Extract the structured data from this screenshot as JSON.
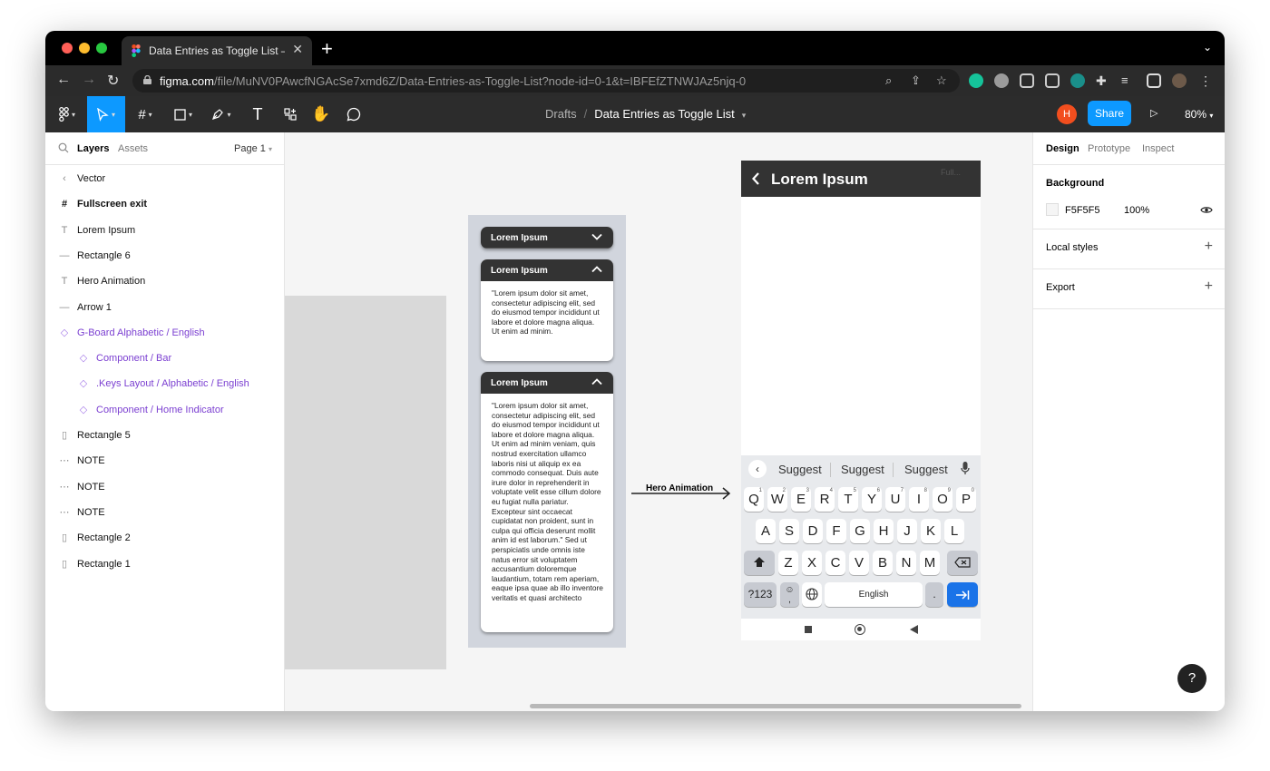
{
  "browser": {
    "tab_title": "Data Entries as Toggle List – Fi",
    "tab_close": "✕",
    "new_tab": "+",
    "url_host": "figma.com",
    "url_path": "/file/MuNV0PAwcfNGAcSe7xmd6Z/Data-Entries-as-Toggle-List?node-id=0-1&t=IBFEfZTNWJAz5njq-0"
  },
  "toolbar": {
    "breadcrumb_parent": "Drafts",
    "breadcrumb_sep": "/",
    "file_name": "Data Entries as Toggle List",
    "user_initial": "H",
    "share_label": "Share",
    "zoom_level": "80%"
  },
  "left_panel": {
    "tab_layers": "Layers",
    "tab_assets": "Assets",
    "page_label": "Page 1",
    "layers": [
      {
        "label": "Vector",
        "icon": "vector-icon"
      },
      {
        "label": "Fullscreen exit",
        "icon": "frame-icon"
      },
      {
        "label": "Lorem Ipsum",
        "icon": "text-icon"
      },
      {
        "label": "Rectangle 6",
        "icon": "line-icon"
      },
      {
        "label": "Hero Animation",
        "icon": "text-icon"
      },
      {
        "label": "Arrow 1",
        "icon": "line-icon"
      },
      {
        "label": "G-Board Alphabetic / English",
        "icon": "component-icon"
      },
      {
        "label": "Component / Bar",
        "icon": "component-icon"
      },
      {
        "label": ".Keys Layout / Alphabetic / English",
        "icon": "component-icon"
      },
      {
        "label": "Component / Home Indicator",
        "icon": "component-icon"
      },
      {
        "label": "Rectangle 5",
        "icon": "rectangle-icon"
      },
      {
        "label": "NOTE",
        "icon": "dashed-frame-icon"
      },
      {
        "label": "NOTE",
        "icon": "dashed-frame-icon"
      },
      {
        "label": "NOTE",
        "icon": "dashed-frame-icon"
      },
      {
        "label": "Rectangle 2",
        "icon": "rectangle-icon"
      },
      {
        "label": "Rectangle 1",
        "icon": "rectangle-icon"
      }
    ]
  },
  "canvas": {
    "cards": [
      {
        "title": "Lorem Ipsum",
        "expanded": false,
        "body": ""
      },
      {
        "title": "Lorem Ipsum",
        "expanded": true,
        "body": "\"Lorem ipsum dolor sit amet, consectetur adipiscing elit, sed do eiusmod tempor incididunt ut labore et dolore magna aliqua. Ut enim ad minim."
      },
      {
        "title": "Lorem Ipsum",
        "expanded": true,
        "body": "\"Lorem ipsum dolor sit amet, consectetur adipiscing elit, sed do eiusmod tempor incididunt ut labore et dolore magna aliqua. Ut enim ad minim veniam, quis nostrud exercitation ullamco laboris nisi ut aliquip ex ea commodo consequat. Duis aute irure dolor in reprehenderit in voluptate velit esse cillum dolore eu fugiat nulla pariatur. Excepteur sint occaecat cupidatat non proident, sunt in culpa qui officia deserunt mollit anim id est laborum.\" Sed ut perspiciatis unde omnis iste natus error sit voluptatem accusantium doloremque laudantium, totam rem aperiam, eaque ipsa quae ab illo inventore veritatis et quasi architecto"
      }
    ],
    "arrow_label": "Hero Animation",
    "phone": {
      "title": "Lorem Ipsum",
      "ghost_text": "Full...",
      "suggestions": [
        "Suggest",
        "Suggest",
        "Suggest"
      ],
      "row1": [
        {
          "k": "Q",
          "n": "1"
        },
        {
          "k": "W",
          "n": "2"
        },
        {
          "k": "E",
          "n": "3"
        },
        {
          "k": "R",
          "n": "4"
        },
        {
          "k": "T",
          "n": "5"
        },
        {
          "k": "Y",
          "n": "6"
        },
        {
          "k": "U",
          "n": "7"
        },
        {
          "k": "I",
          "n": "8"
        },
        {
          "k": "O",
          "n": "9"
        },
        {
          "k": "P",
          "n": "0"
        }
      ],
      "row2": [
        "A",
        "S",
        "D",
        "F",
        "G",
        "H",
        "J",
        "K",
        "L"
      ],
      "row3": [
        "Z",
        "X",
        "C",
        "V",
        "B",
        "N",
        "M"
      ],
      "sym_key": "?123",
      "emoji_key": "☺",
      "comma": ",",
      "space_key": "English",
      "period_key": "."
    }
  },
  "right_panel": {
    "tab_design": "Design",
    "tab_prototype": "Prototype",
    "tab_inspect": "Inspect",
    "background_label": "Background",
    "background_hex": "F5F5F5",
    "background_opacity": "100%",
    "local_styles_label": "Local styles",
    "export_label": "Export"
  },
  "help_label": "?",
  "colors": {
    "figma_blue": "#0d99ff",
    "component_purple": "#7b3fd1",
    "card_header": "#333333",
    "keyboard_action": "#1a73e8"
  }
}
